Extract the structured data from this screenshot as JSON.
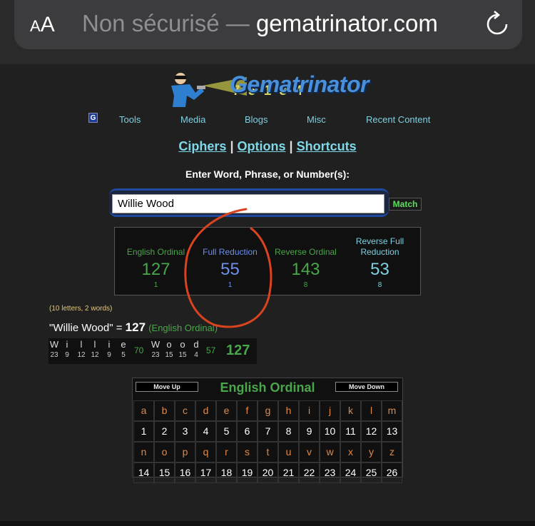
{
  "browser": {
    "aa_small": "A",
    "aa_large": "A",
    "url_prefix": "Non sécurisé — ",
    "url_host": "gematrinator.com"
  },
  "logo": {
    "title": "Gematrinator",
    "numbers": "7 5 1 3 4"
  },
  "nav": [
    "Tools",
    "Media",
    "Blogs",
    "Misc",
    "Recent Content"
  ],
  "links": {
    "ciphers": "Ciphers",
    "options": "Options",
    "shortcuts": "Shortcuts",
    "sep": "|"
  },
  "prompt": "Enter Word, Phrase, or Number(s):",
  "input_value": "Willie Wood",
  "match_label": "Match",
  "ciphers": [
    {
      "name": "English Ordinal",
      "value": "127",
      "sub": "1",
      "color": "#4aa64a"
    },
    {
      "name": "Full Reduction",
      "value": "55",
      "sub": "1",
      "color": "#6f8fe8"
    },
    {
      "name": "Reverse Ordinal",
      "value": "143",
      "sub": "8",
      "color": "#4aa64a"
    },
    {
      "name": "Reverse Full Reduction",
      "value": "53",
      "sub": "8",
      "color": "#7fd0e0"
    }
  ],
  "meta": "(10 letters, 2 words)",
  "result": {
    "phrase": "\"Willie Wood\" = ",
    "value": "127",
    "cipher": "(English Ordinal)"
  },
  "breakdown": {
    "word1": [
      [
        "W",
        "23"
      ],
      [
        "i",
        "9"
      ],
      [
        "l",
        "12"
      ],
      [
        "l",
        "12"
      ],
      [
        "i",
        "9"
      ],
      [
        "e",
        "5"
      ]
    ],
    "word1_sum": "70",
    "word2": [
      [
        "W",
        "23"
      ],
      [
        "o",
        "15"
      ],
      [
        "o",
        "15"
      ],
      [
        "d",
        "4"
      ]
    ],
    "word2_sum": "57",
    "total": "127"
  },
  "table": {
    "move_up": "Move Up",
    "move_down": "Move Down",
    "title": "English Ordinal",
    "row1_letters": [
      "a",
      "b",
      "c",
      "d",
      "e",
      "f",
      "g",
      "h",
      "i",
      "j",
      "k",
      "l",
      "m"
    ],
    "row1_values": [
      "1",
      "2",
      "3",
      "4",
      "5",
      "6",
      "7",
      "8",
      "9",
      "10",
      "11",
      "12",
      "13"
    ],
    "row2_letters": [
      "n",
      "o",
      "p",
      "q",
      "r",
      "s",
      "t",
      "u",
      "v",
      "w",
      "x",
      "y",
      "z"
    ],
    "row2_values": [
      "14",
      "15",
      "16",
      "17",
      "18",
      "19",
      "20",
      "21",
      "22",
      "23",
      "24",
      "25",
      "26"
    ]
  },
  "colors": {
    "accent_green": "#4aa64a",
    "link_cyan": "#7fd8e8",
    "annotation_red": "#d9431f"
  }
}
